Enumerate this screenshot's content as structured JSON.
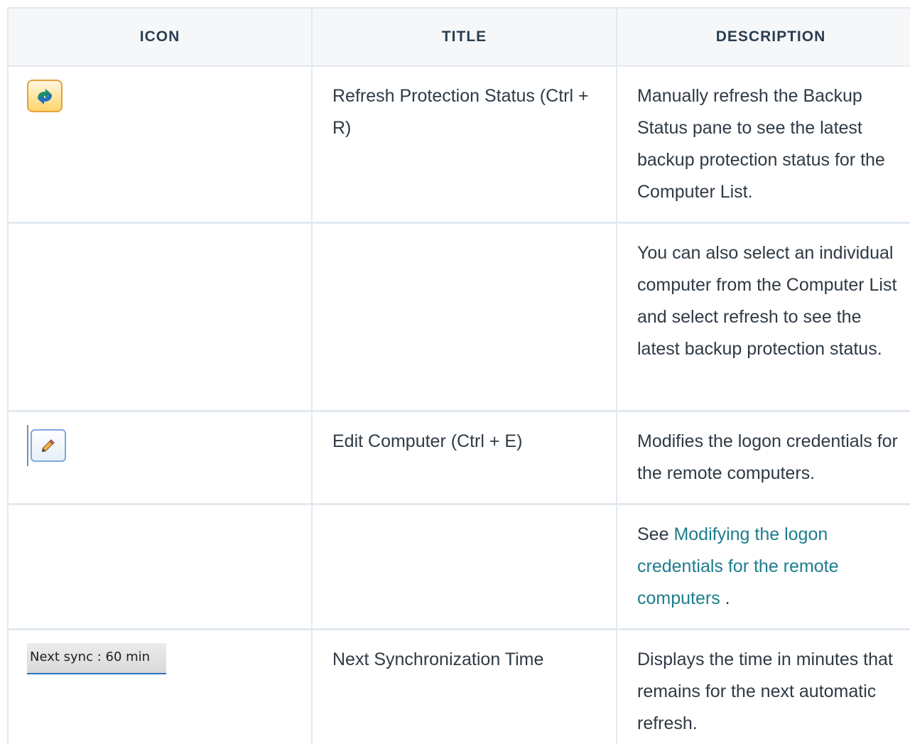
{
  "table": {
    "headers": {
      "icon": "ICON",
      "title": "TITLE",
      "description": "DESCRIPTION"
    },
    "rows": [
      {
        "icon": "refresh-icon",
        "title": "Refresh Protection Status (Ctrl + R)",
        "description": "Manually refresh the Backup Status pane to see the latest backup protection status for the Computer List."
      },
      {
        "icon": "",
        "title": "",
        "description": "You can also select an individual computer from the Computer List and select refresh to see the latest backup protection status."
      },
      {
        "icon": "edit-icon",
        "title": "Edit Computer (Ctrl + E)",
        "description": "Modifies the logon credentials for the remote computers."
      },
      {
        "icon": "",
        "title": "",
        "description_prefix": "See ",
        "description_link": "Modifying the logon credentials for the remote computers",
        "description_suffix": " ."
      },
      {
        "icon_text": "Next sync : 60 min",
        "title": "Next Synchronization Time",
        "description": "Displays the time in minutes that remains for the next automatic refresh."
      }
    ]
  },
  "colors": {
    "link": "#1e7d8c",
    "text": "#2f3a45",
    "border": "#e3e9f0"
  }
}
